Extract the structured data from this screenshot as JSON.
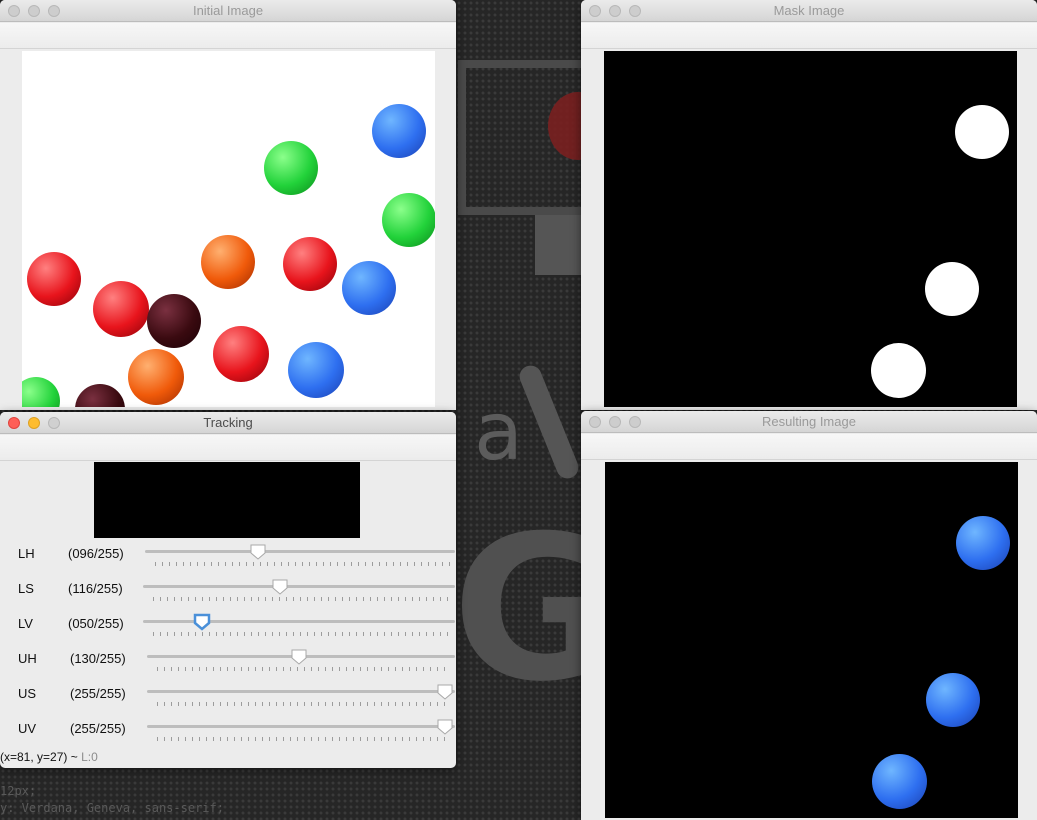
{
  "windows": {
    "initial": {
      "title": "Initial Image"
    },
    "mask": {
      "title": "Mask Image"
    },
    "tracking": {
      "title": "Tracking"
    },
    "result": {
      "title": "Resulting Image"
    }
  },
  "tracking": {
    "status_coords": "(x=81, y=27) ~",
    "status_value": "L:0",
    "sliders": [
      {
        "label": "LH",
        "value_text": "(096/255)",
        "value": 96,
        "max": 255
      },
      {
        "label": "LS",
        "value_text": "(116/255)",
        "value": 116,
        "max": 255
      },
      {
        "label": "LV",
        "value_text": "(050/255)",
        "value": 50,
        "max": 255
      },
      {
        "label": "UH",
        "value_text": "(130/255)",
        "value": 130,
        "max": 255
      },
      {
        "label": "US",
        "value_text": "(255/255)",
        "value": 255,
        "max": 255
      },
      {
        "label": "UV",
        "value_text": "(255/255)",
        "value": 255,
        "max": 255
      }
    ]
  },
  "background_terminal": {
    "line1": "12px;",
    "line2": "y: Verdana, Geneva, sans-serif;"
  },
  "colors": {
    "candy_red": "#e8141c",
    "candy_green": "#22d23a",
    "candy_blue": "#2e6ff0",
    "candy_orange": "#f05a0a",
    "candy_brown": "#3a0a10",
    "mask_white": "#ffffff",
    "canvas_black": "#000000",
    "active_slider": "#4a90d9"
  }
}
